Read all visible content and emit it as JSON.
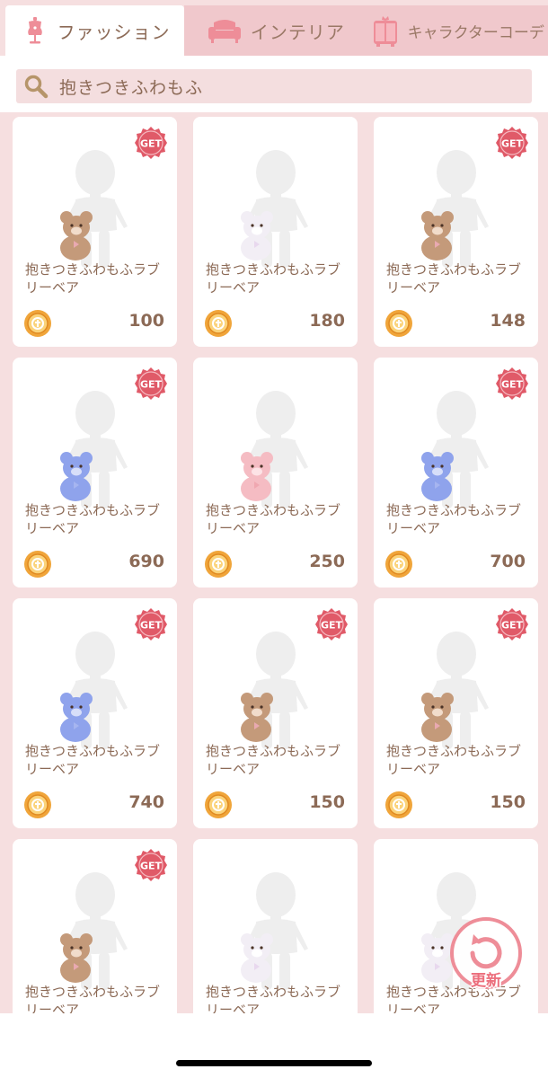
{
  "tabs": [
    {
      "label": "ファッション",
      "icon": "mannequin-icon",
      "active": true
    },
    {
      "label": "インテリア",
      "icon": "sofa-icon",
      "active": false
    },
    {
      "label": "キャラクターコーデ",
      "icon": "character-wardrobe-icon",
      "active": false
    }
  ],
  "search": {
    "value": "抱きつきふわもふ",
    "icon": "search-icon"
  },
  "items": [
    {
      "name": "抱きつきふわもふラブリーベア",
      "price": "100",
      "get": true,
      "bear_color": "brown"
    },
    {
      "name": "抱きつきふわもふラブリーベア",
      "price": "180",
      "get": false,
      "bear_color": "white"
    },
    {
      "name": "抱きつきふわもふラブリーベア",
      "price": "148",
      "get": true,
      "bear_color": "brown"
    },
    {
      "name": "抱きつきふわもふラブリーベア",
      "price": "690",
      "get": true,
      "bear_color": "blue"
    },
    {
      "name": "抱きつきふわもふラブリーベア",
      "price": "250",
      "get": false,
      "bear_color": "pink"
    },
    {
      "name": "抱きつきふわもふラブリーベア",
      "price": "700",
      "get": true,
      "bear_color": "blue"
    },
    {
      "name": "抱きつきふわもふラブリーベア",
      "price": "740",
      "get": true,
      "bear_color": "blue"
    },
    {
      "name": "抱きつきふわもふラブリーベア",
      "price": "150",
      "get": true,
      "bear_color": "brown"
    },
    {
      "name": "抱きつきふわもふラブリーベア",
      "price": "150",
      "get": true,
      "bear_color": "brown"
    },
    {
      "name": "抱きつきふわもふラブリーベア",
      "price": "",
      "get": true,
      "bear_color": "brown"
    },
    {
      "name": "抱きつきふわもふラブリーベア",
      "price": "",
      "get": false,
      "bear_color": "white"
    },
    {
      "name": "抱きつきふわもふラブリーベア",
      "price": "",
      "get": false,
      "bear_color": "white"
    }
  ],
  "get_badge": "GET",
  "refresh_label": "更新",
  "colors": {
    "accent": "#e05a68",
    "text": "#8c6a56",
    "background": "#f6dfe0",
    "coin": "#f0a53a"
  }
}
